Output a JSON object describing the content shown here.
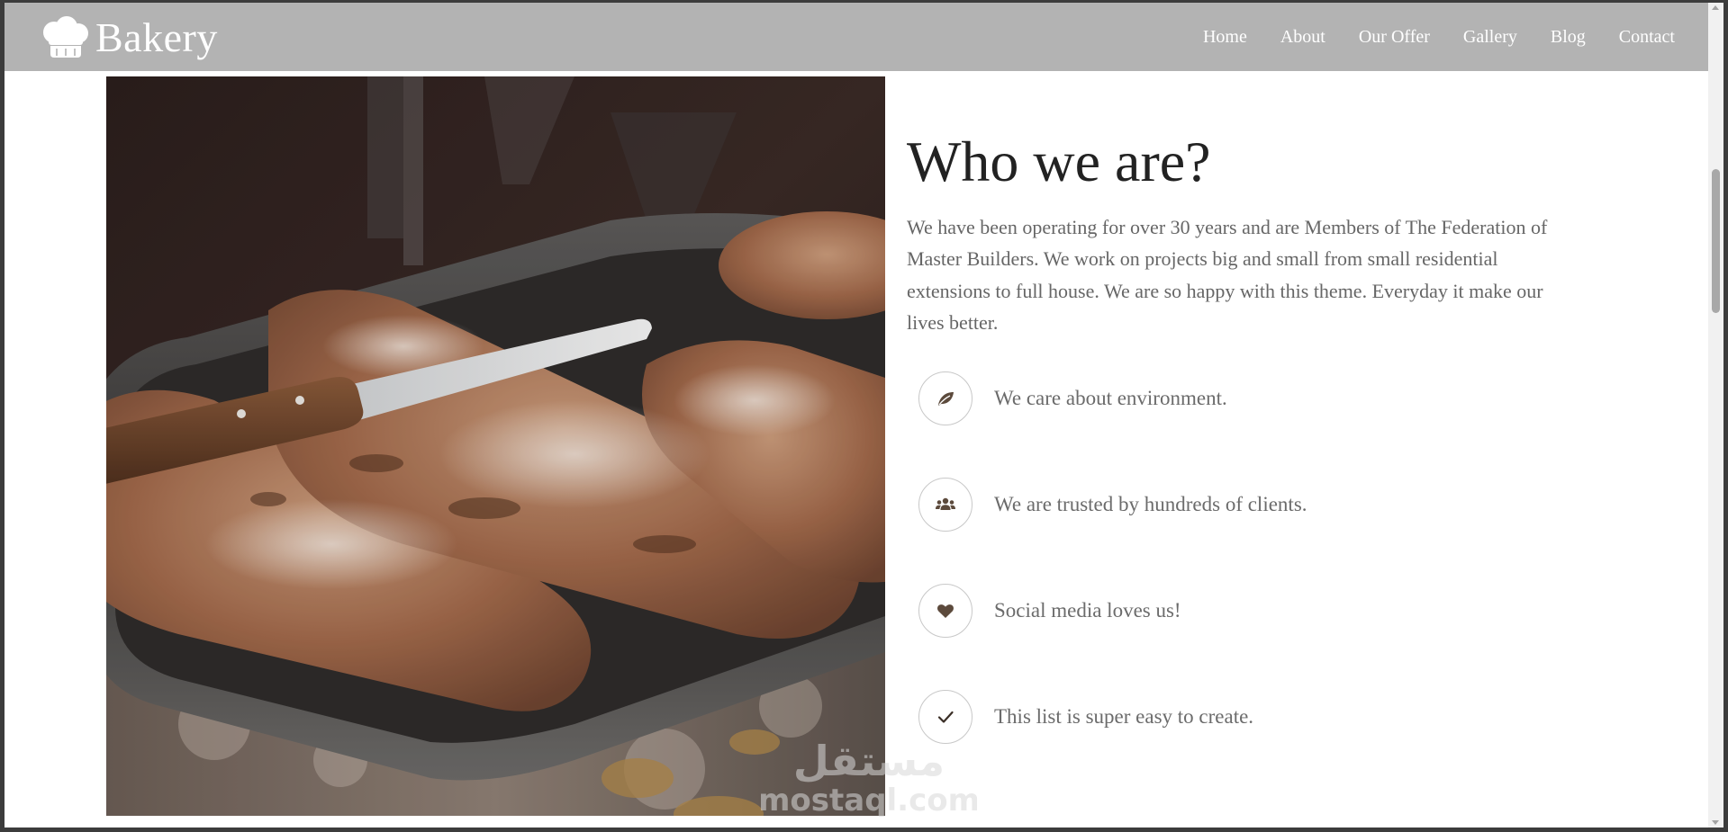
{
  "brand": {
    "name": "Bakery",
    "icon": "chef-hat-icon"
  },
  "nav": {
    "items": [
      {
        "label": "Home"
      },
      {
        "label": "About"
      },
      {
        "label": "Our Offer"
      },
      {
        "label": "Gallery"
      },
      {
        "label": "Blog"
      },
      {
        "label": "Contact"
      }
    ]
  },
  "about": {
    "heading": "Who we are?",
    "intro": "We have been operating for over 30 years and are Members of The Federation of Master Builders. We work on projects big and small from small residential extensions to full house. We are so happy with this theme. Everyday it make our lives better.",
    "photo": "bread-loaves-on-tray-image",
    "features": [
      {
        "icon": "leaf-icon",
        "text": "We care about environment."
      },
      {
        "icon": "users-icon",
        "text": "We are trusted by hundreds of clients."
      },
      {
        "icon": "heart-icon",
        "text": "Social media loves us!"
      },
      {
        "icon": "check-icon",
        "text": "This list is super easy to create."
      }
    ]
  },
  "watermark": {
    "arabic": "مستقل",
    "latin": "mostaql.com"
  },
  "colors": {
    "navbar_bg": "#b3b3b3",
    "accent_brown": "#6b4a2e",
    "heading": "#222222",
    "body_text": "#666666"
  }
}
